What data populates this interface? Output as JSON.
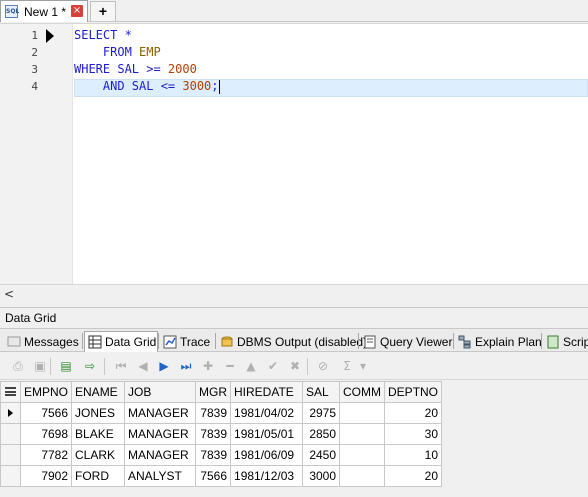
{
  "document_tab": {
    "icon": "sql-file-icon",
    "icon_text": "SQL",
    "label": "New 1 *",
    "close": "×",
    "new_tab": "+"
  },
  "editor": {
    "line_numbers": [
      "1",
      "2",
      "3",
      "4"
    ],
    "lines": [
      [
        {
          "t": "SELECT *",
          "c": "kw"
        }
      ],
      [
        {
          "t": "    FROM ",
          "c": "kw"
        },
        {
          "t": "EMP",
          "c": "ident"
        }
      ],
      [
        {
          "t": "WHERE SAL >= ",
          "c": "kw"
        },
        {
          "t": "2000",
          "c": "num"
        }
      ],
      [
        {
          "t": "    AND SAL <= ",
          "c": "kw"
        },
        {
          "t": "3000",
          "c": "num"
        },
        {
          "t": ";",
          "c": "kw"
        }
      ]
    ]
  },
  "scrollbar": {
    "left_arrow": "<"
  },
  "panel_title": "Data Grid",
  "bottom_tabs": [
    {
      "id": "messages",
      "label": "Messages",
      "icon": "messages-icon"
    },
    {
      "id": "data-grid",
      "label": "Data Grid",
      "icon": "grid-icon",
      "active": true
    },
    {
      "id": "trace",
      "label": "Trace",
      "icon": "trace-icon"
    },
    {
      "id": "dbms-output",
      "label": "DBMS Output (disabled)",
      "icon": "dbms-output-icon"
    },
    {
      "id": "query-viewer",
      "label": "Query Viewer",
      "icon": "query-viewer-icon"
    },
    {
      "id": "explain-plan",
      "label": "Explain Plan",
      "icon": "explain-plan-icon"
    },
    {
      "id": "script",
      "label": "Scrip",
      "icon": "script-icon"
    }
  ],
  "toolbar": {
    "buttons": [
      {
        "id": "print",
        "icon": "print-icon",
        "glyph": "⎙",
        "state": "disabled"
      },
      {
        "id": "save",
        "icon": "save-icon",
        "glyph": "▣",
        "state": "disabled"
      },
      {
        "id": "copy-rows",
        "icon": "copy-rows-icon",
        "glyph": "▤",
        "state": "normal"
      },
      {
        "id": "export",
        "icon": "export-icon",
        "glyph": "⇨",
        "state": "normal"
      },
      {
        "id": "first",
        "icon": "first-record-icon",
        "glyph": "⏮",
        "state": "disabled"
      },
      {
        "id": "prior",
        "icon": "prior-record-icon",
        "glyph": "◀",
        "state": "disabled"
      },
      {
        "id": "next",
        "icon": "next-record-icon",
        "glyph": "▶",
        "state": "blue"
      },
      {
        "id": "last",
        "icon": "last-record-icon",
        "glyph": "⏭",
        "state": "blue"
      },
      {
        "id": "insert",
        "icon": "insert-record-icon",
        "glyph": "✚",
        "state": "disabled"
      },
      {
        "id": "delete",
        "icon": "delete-record-icon",
        "glyph": "━",
        "state": "disabled"
      },
      {
        "id": "edit",
        "icon": "edit-record-icon",
        "glyph": "▲",
        "state": "disabled"
      },
      {
        "id": "post",
        "icon": "post-record-icon",
        "glyph": "✔",
        "state": "disabled"
      },
      {
        "id": "cancel",
        "icon": "cancel-record-icon",
        "glyph": "✖",
        "state": "disabled"
      },
      {
        "id": "filter",
        "icon": "filter-icon",
        "glyph": "⊘",
        "state": "disabled"
      },
      {
        "id": "sum",
        "icon": "sum-icon",
        "glyph": "Σ",
        "state": "disabled"
      },
      {
        "id": "sum-menu",
        "icon": "dropdown-arrow-icon",
        "glyph": "▾",
        "state": "disabled"
      }
    ]
  },
  "grid": {
    "columns": [
      "EMPNO",
      "ENAME",
      "JOB",
      "MGR",
      "HIREDATE",
      "SAL",
      "COMM",
      "DEPTNO"
    ],
    "numeric": [
      true,
      false,
      false,
      true,
      false,
      true,
      true,
      true
    ],
    "rows": [
      [
        "7566",
        "JONES",
        "MANAGER",
        "7839",
        "1981/04/02",
        "2975",
        "",
        "20"
      ],
      [
        "7698",
        "BLAKE",
        "MANAGER",
        "7839",
        "1981/05/01",
        "2850",
        "",
        "30"
      ],
      [
        "7782",
        "CLARK",
        "MANAGER",
        "7839",
        "1981/06/09",
        "2450",
        "",
        "10"
      ],
      [
        "7902",
        "FORD",
        "ANALYST",
        "7566",
        "1981/12/03",
        "3000",
        "",
        "20"
      ]
    ],
    "current_row": 0
  }
}
